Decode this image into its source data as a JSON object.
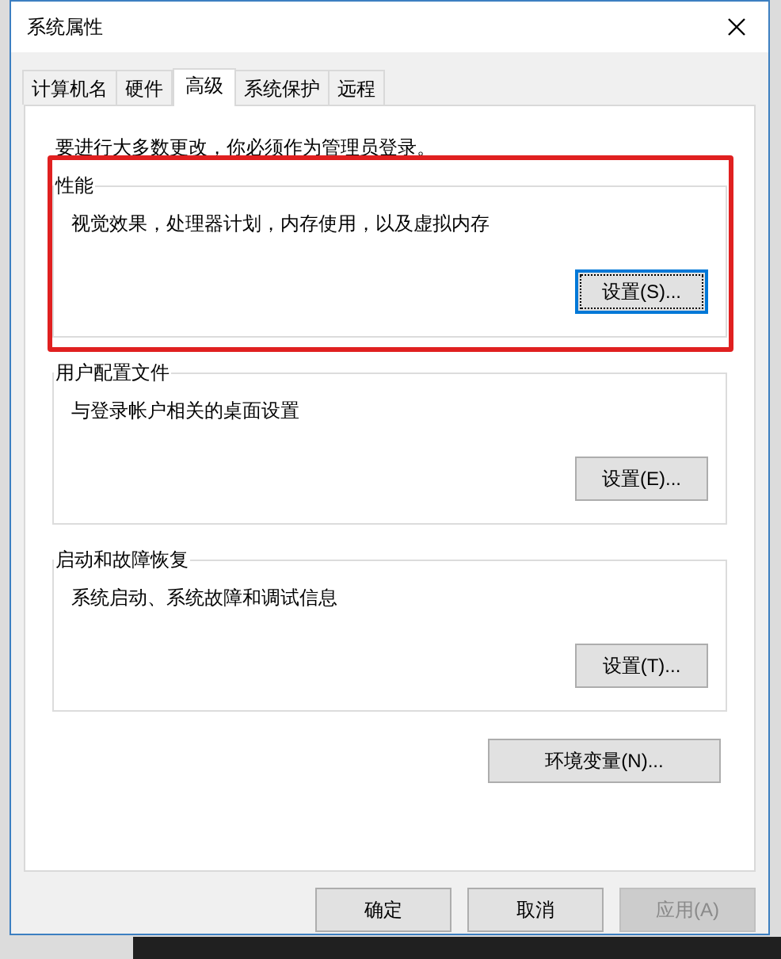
{
  "window": {
    "title": "系统属性"
  },
  "tabs": [
    {
      "label": "计算机名",
      "selected": false
    },
    {
      "label": "硬件",
      "selected": false
    },
    {
      "label": "高级",
      "selected": true
    },
    {
      "label": "系统保护",
      "selected": false
    },
    {
      "label": "远程",
      "selected": false
    }
  ],
  "notice": "要进行大多数更改，你必须作为管理员登录。",
  "groups": [
    {
      "title": "性能",
      "description": "视觉效果，处理器计划，内存使用，以及虚拟内存",
      "button": "设置(S)...",
      "focused": true,
      "highlighted": true
    },
    {
      "title": "用户配置文件",
      "description": "与登录帐户相关的桌面设置",
      "button": "设置(E)...",
      "focused": false,
      "highlighted": false
    },
    {
      "title": "启动和故障恢复",
      "description": "系统启动、系统故障和调试信息",
      "button": "设置(T)...",
      "focused": false,
      "highlighted": false
    }
  ],
  "env_button": "环境变量(N)...",
  "buttons": [
    {
      "label": "确定",
      "disabled": false
    },
    {
      "label": "取消",
      "disabled": false
    },
    {
      "label": "应用(A)",
      "disabled": true
    }
  ]
}
